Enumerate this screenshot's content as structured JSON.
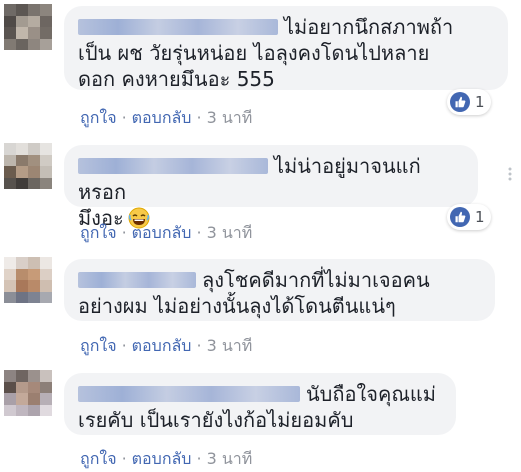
{
  "actions": {
    "like_label": "ถูกใจ",
    "reply_label": "ตอบกลับ",
    "separator": "·"
  },
  "comments": [
    {
      "name": "████████ ████████",
      "text": "ไม่อยากนึกสภาพถ้า\nเป็น ผช วัยรุ่นหน่อย ไอลุงคงโดนไปหลาย\nดอก คงหายมึนอะ 555",
      "time": "3 นาที",
      "reactions": "1"
    },
    {
      "name": "██████ ██████",
      "text": "ไม่น่าอยู่มาจนแก่หรอก\nมึงอะ",
      "emoji": "laughing-face",
      "time": "3 นาที",
      "reactions": "1"
    },
    {
      "name": "████ █████",
      "text": "ลุงโชคดีมากที่ไม่มาเจอคน\nอย่างผม ไม่อย่างนั้นลุงได้โดนตีนแน่ๆ",
      "time": "3 นาที"
    },
    {
      "name": "███ ██████ ████████",
      "text": "นับถือใจคุณแม่\nเรยคับ เป็นเรายังไงก้อไม่ยอมคับ",
      "time": "3 นาที"
    }
  ],
  "colors": {
    "link": "#4267b2",
    "muted": "#90949c",
    "bubble": "#f2f3f5",
    "text": "#1d2129"
  }
}
